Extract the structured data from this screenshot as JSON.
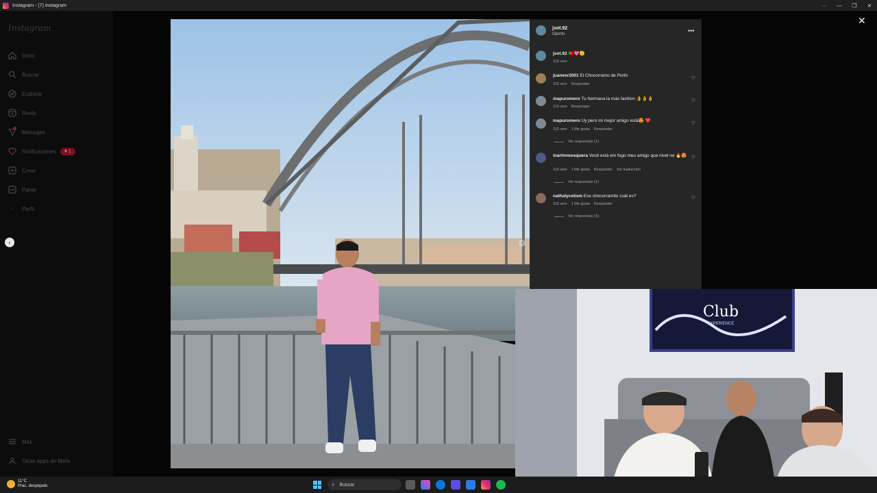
{
  "window": {
    "title": "Instagram - (7) Instagram"
  },
  "sidebar": {
    "logo": "Instagram",
    "items": [
      {
        "label": "Inicio",
        "icon": "home-icon"
      },
      {
        "label": "Buscar",
        "icon": "search-icon"
      },
      {
        "label": "Explorar",
        "icon": "compass-icon"
      },
      {
        "label": "Reels",
        "icon": "reels-icon"
      },
      {
        "label": "Mensajes",
        "icon": "messenger-icon"
      },
      {
        "label": "Notificaciones",
        "icon": "heart-icon",
        "badge": "1"
      },
      {
        "label": "Crear",
        "icon": "plus-square-icon"
      },
      {
        "label": "Panel",
        "icon": "dashboard-icon"
      },
      {
        "label": "Perfil",
        "icon": "profile-icon"
      }
    ],
    "bottom": [
      {
        "label": "Más",
        "icon": "menu-icon"
      },
      {
        "label": "Otras apps de Meta",
        "icon": "meta-apps-icon"
      }
    ]
  },
  "post": {
    "username": "jsot.92",
    "location": "Oporto",
    "caption": {
      "user": "jsot.92",
      "text": "🇵🇹💖🫡",
      "time": "116 sem"
    },
    "comments": [
      {
        "user": "juanesr2001",
        "text": "El Chocorramo de Porto",
        "time": "116 sem",
        "likes": "",
        "reply": "Responder",
        "translate": "",
        "replies": ""
      },
      {
        "user": "mapuromero",
        "text": "Tu hermana la más fashion 👌👌👌",
        "time": "116 sem",
        "likes": "",
        "reply": "Responder",
        "translate": "",
        "replies": ""
      },
      {
        "user": "mapuromero",
        "text": "Uy pero mi mejor amigo está😍 ❤️",
        "time": "116 sem",
        "likes": "1 Me gusta",
        "reply": "Responder",
        "translate": "",
        "replies": "Ver respuestas (1)"
      },
      {
        "user": "martinmosquera",
        "text": "Você está em fogo meu amigo que nivel rei 🔥😍",
        "time": "116 sem",
        "likes": "1 Me gusta",
        "reply": "Responder",
        "translate": "Ver traducción",
        "replies": "Ver respuestas (1)"
      },
      {
        "user": "nathalycelism",
        "text": "Ese chocorramito cuál es?",
        "time": "116 sem",
        "likes": "1 Me gusta",
        "reply": "Responder",
        "translate": "",
        "replies": "Ver respuestas (1)"
      }
    ]
  },
  "webcam": {
    "sign_text": "Club",
    "sign_sub": "EXPERIENCE"
  },
  "taskbar": {
    "weather_temp": "11°C",
    "weather_desc": "Prac. despejado",
    "search_label": "Buscar"
  },
  "colors": {
    "accent": "#e1306c",
    "panel_bg": "#262626",
    "taskbar_bg": "#1c1c1c"
  }
}
